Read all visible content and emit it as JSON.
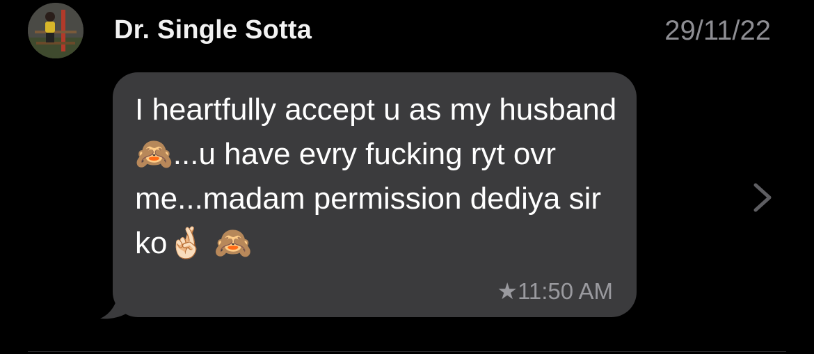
{
  "conversation_row": {
    "sender_name": "Dr. Single Sotta",
    "date": "29/11/22",
    "message_text": "I heartfully accept u as my husband🙈...u have evry fucking ryt ovr me...madam permission dediya sir ko🤞🏻 🙈",
    "timestamp": "★11:50 AM",
    "avatar_icon": "profile-photo",
    "disclosure_icon": "chevron-right-icon"
  },
  "colors": {
    "background": "#000000",
    "bubble": "#3b3b3d",
    "secondary_text": "#8e8e93",
    "primary_text": "#ffffff"
  }
}
